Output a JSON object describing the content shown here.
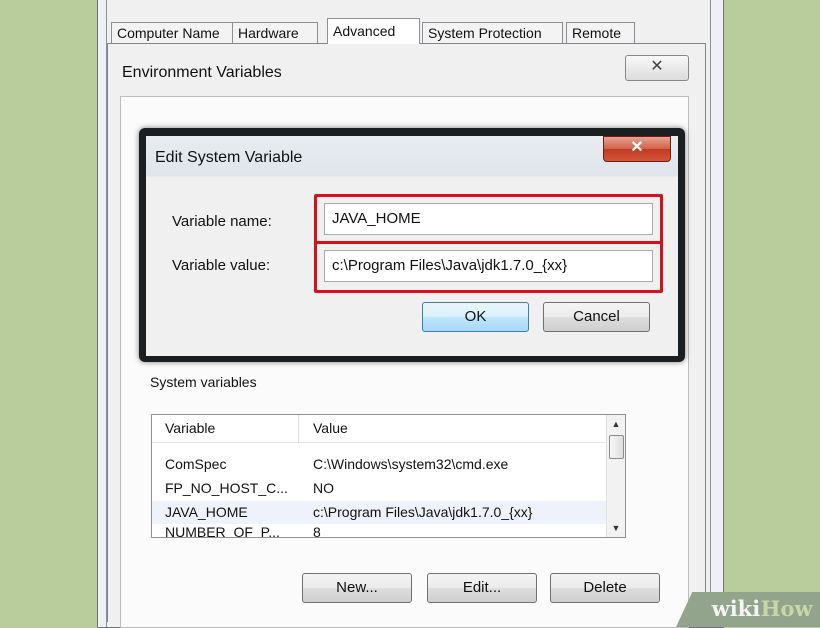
{
  "system_properties": {
    "tabs": [
      {
        "label": "Computer Name"
      },
      {
        "label": "Hardware"
      },
      {
        "label": "Advanced"
      },
      {
        "label": "System Protection"
      },
      {
        "label": "Remote"
      }
    ],
    "active_tab": "Advanced"
  },
  "environment_variables": {
    "title": "Environment Variables",
    "close_glyph": "✕",
    "system_variables": {
      "label": "System variables",
      "columns": [
        "Variable",
        "Value"
      ],
      "rows": [
        {
          "variable": "ComSpec",
          "value": "C:\\Windows\\system32\\cmd.exe"
        },
        {
          "variable": "FP_NO_HOST_C...",
          "value": "NO"
        },
        {
          "variable": "JAVA_HOME",
          "value": "c:\\Program Files\\Java\\jdk1.7.0_{xx}"
        },
        {
          "variable": "NUMBER_OF_P...",
          "value": "8"
        }
      ],
      "scroll_up_glyph": "▲",
      "scroll_down_glyph": "▼"
    },
    "buttons": {
      "new": "New...",
      "edit": "Edit...",
      "delete": "Delete"
    }
  },
  "edit_system_variable": {
    "title": "Edit System Variable",
    "close_glyph": "✕",
    "variable_name_label": "Variable name:",
    "variable_name_value": "JAVA_HOME",
    "variable_value_label": "Variable value:",
    "variable_value_value": "c:\\Program Files\\Java\\jdk1.7.0_{xx}",
    "ok_label": "OK",
    "cancel_label": "Cancel",
    "highlight_color": "#d7111a"
  },
  "watermark": {
    "part1": "wiki",
    "part2": "How"
  }
}
